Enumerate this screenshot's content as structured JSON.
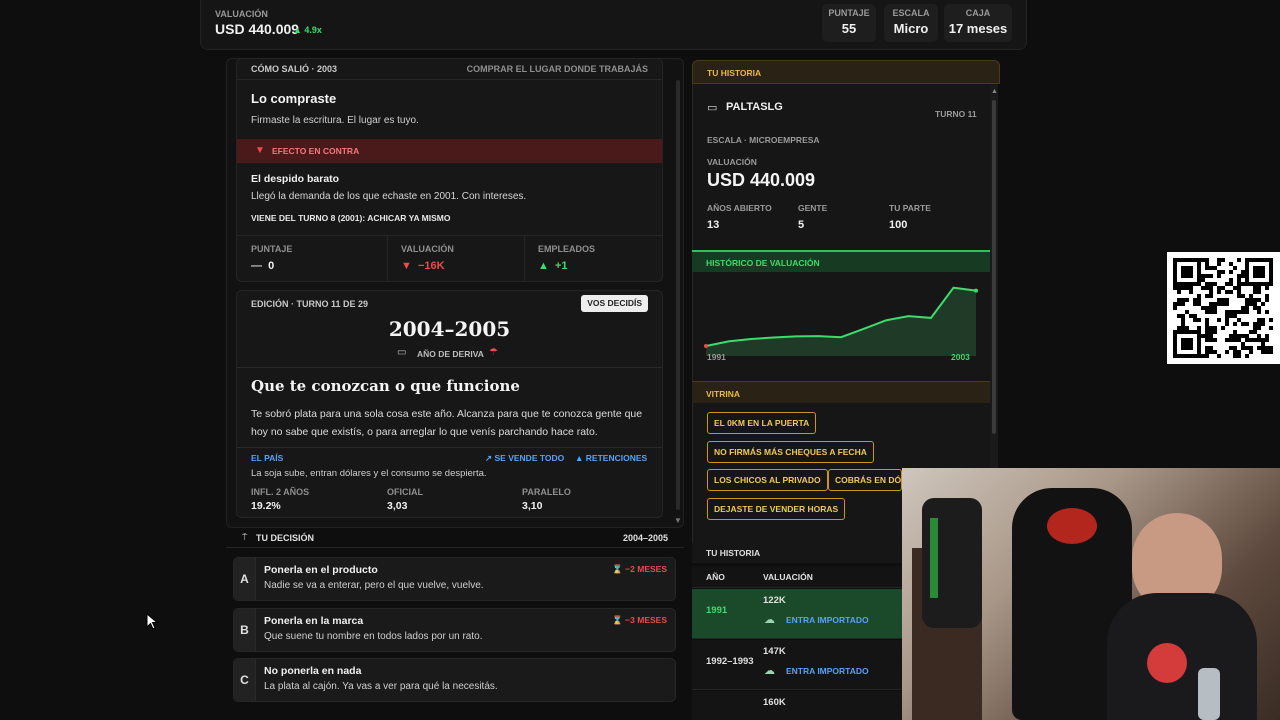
{
  "topbar": {
    "valuation_label": "VALUACIÓN",
    "valuation_value": "USD 440.009",
    "valuation_change": "▲ 4.9x",
    "stats": [
      {
        "label": "PUNTAJE",
        "value": "55"
      },
      {
        "label": "ESCALA",
        "value": "Micro"
      },
      {
        "label": "CAJA",
        "value": "17 meses"
      }
    ]
  },
  "outcome": {
    "header_left": "CÓMO SALIÓ · 2003",
    "header_right": "COMPRAR EL LUGAR DONDE TRABAJÁS",
    "title": "Lo compraste",
    "text": "Firmaste la escritura. El lugar es tuyo.",
    "effect_label": "EFECTO EN CONTRA",
    "effect_title": "El despido barato",
    "effect_text": "Llegó la demanda de los que echaste en 2001. Con intereses.",
    "effect_origin": "VIENE DEL TURNO 8 (2001): ACHICAR YA MISMO",
    "metrics": [
      {
        "label": "PUNTAJE",
        "icon": "—",
        "value": "0",
        "color": "#e0e0e0"
      },
      {
        "label": "VALUACIÓN",
        "icon": "▼",
        "value": "−16K",
        "color": "#ee4a4a"
      },
      {
        "label": "EMPLEADOS",
        "icon": "▲",
        "value": "+1",
        "color": "#3ddc6b"
      }
    ]
  },
  "edition": {
    "label": "EDICIÓN · TURNO 11 DE 29",
    "badge": "VOS DECIDÍS",
    "years": "2004–2005",
    "drift": "AÑO DE DERIVA",
    "headline": "Que te conozcan o que funcione",
    "body": "Te sobró plata para una sola cosa este año. Alcanza para que te conozca gente que hoy no sabe que existís, o para arreglar lo que venís parchando hace rato.",
    "country_label": "EL PAÍS",
    "sells_label": "SE VENDE TODO",
    "retentions_label": "RETENCIONES",
    "country_text": "La soja sube, entran dólares y el consumo se despierta.",
    "indicators": [
      {
        "label": "INFL. 2 AÑOS",
        "value": "19.2%"
      },
      {
        "label": "OFICIAL",
        "value": "3,03"
      },
      {
        "label": "PARALELO",
        "value": "3,10"
      }
    ]
  },
  "decision": {
    "label": "TU DECISIÓN",
    "years": "2004–2005",
    "options": [
      {
        "key": "A",
        "title": "Ponerla en el producto",
        "desc": "Nadie se va a enterar, pero el que vuelve, vuelve.",
        "cost": "⌛ −2 MESES"
      },
      {
        "key": "B",
        "title": "Ponerla en la marca",
        "desc": "Que suene tu nombre en todos lados por un rato.",
        "cost": "⌛ −3 MESES"
      },
      {
        "key": "C",
        "title": "No ponerla en nada",
        "desc": "La plata al cajón. Ya vas a ver para qué la necesitás.",
        "cost": ""
      }
    ]
  },
  "story": {
    "header": "TU HISTORIA",
    "company": "PALTASLG",
    "turn": "TURNO 11",
    "scale": "ESCALA · MICROEMPRESA",
    "valuation_label": "VALUACIÓN",
    "valuation_value": "USD 440.009",
    "stats": [
      {
        "label": "AÑOS ABIERTO",
        "value": "13"
      },
      {
        "label": "GENTE",
        "value": "5"
      },
      {
        "label": "TU PARTE",
        "value": "100"
      }
    ],
    "chart_header": "HISTÓRICO DE VALUACIÓN",
    "chart_start": "1991",
    "chart_end": "2003",
    "showcase_header": "VITRINA",
    "showcase_items": [
      "EL 0KM EN LA PUERTA",
      "NO FIRMÁS MÁS CHEQUES A FECHA",
      "LOS CHICOS AL PRIVADO",
      "COBRÁS EN DÓL",
      "DEJASTE DE VENDER HORAS"
    ],
    "history_header": "TU HISTORIA",
    "history_cols": [
      "AÑO",
      "VALUACIÓN"
    ],
    "history_rows": [
      {
        "year": "1991",
        "value": "122K",
        "tag": "ENTRA IMPORTADO"
      },
      {
        "year": "1992–1993",
        "value": "147K",
        "tag": "ENTRA IMPORTADO"
      },
      {
        "year": "",
        "value": "160K",
        "tag": ""
      }
    ]
  },
  "chart_data": {
    "type": "area",
    "x": [
      1991,
      1992,
      1993,
      1994,
      1995,
      1996,
      1997,
      1998,
      1999,
      2000,
      2001,
      2002,
      2003
    ],
    "values": [
      122,
      147,
      160,
      168,
      174,
      176,
      170,
      215,
      262,
      285,
      275,
      440,
      424
    ],
    "color": "#3ddc6b",
    "xlabel_start": "1991",
    "xlabel_end": "2003"
  }
}
